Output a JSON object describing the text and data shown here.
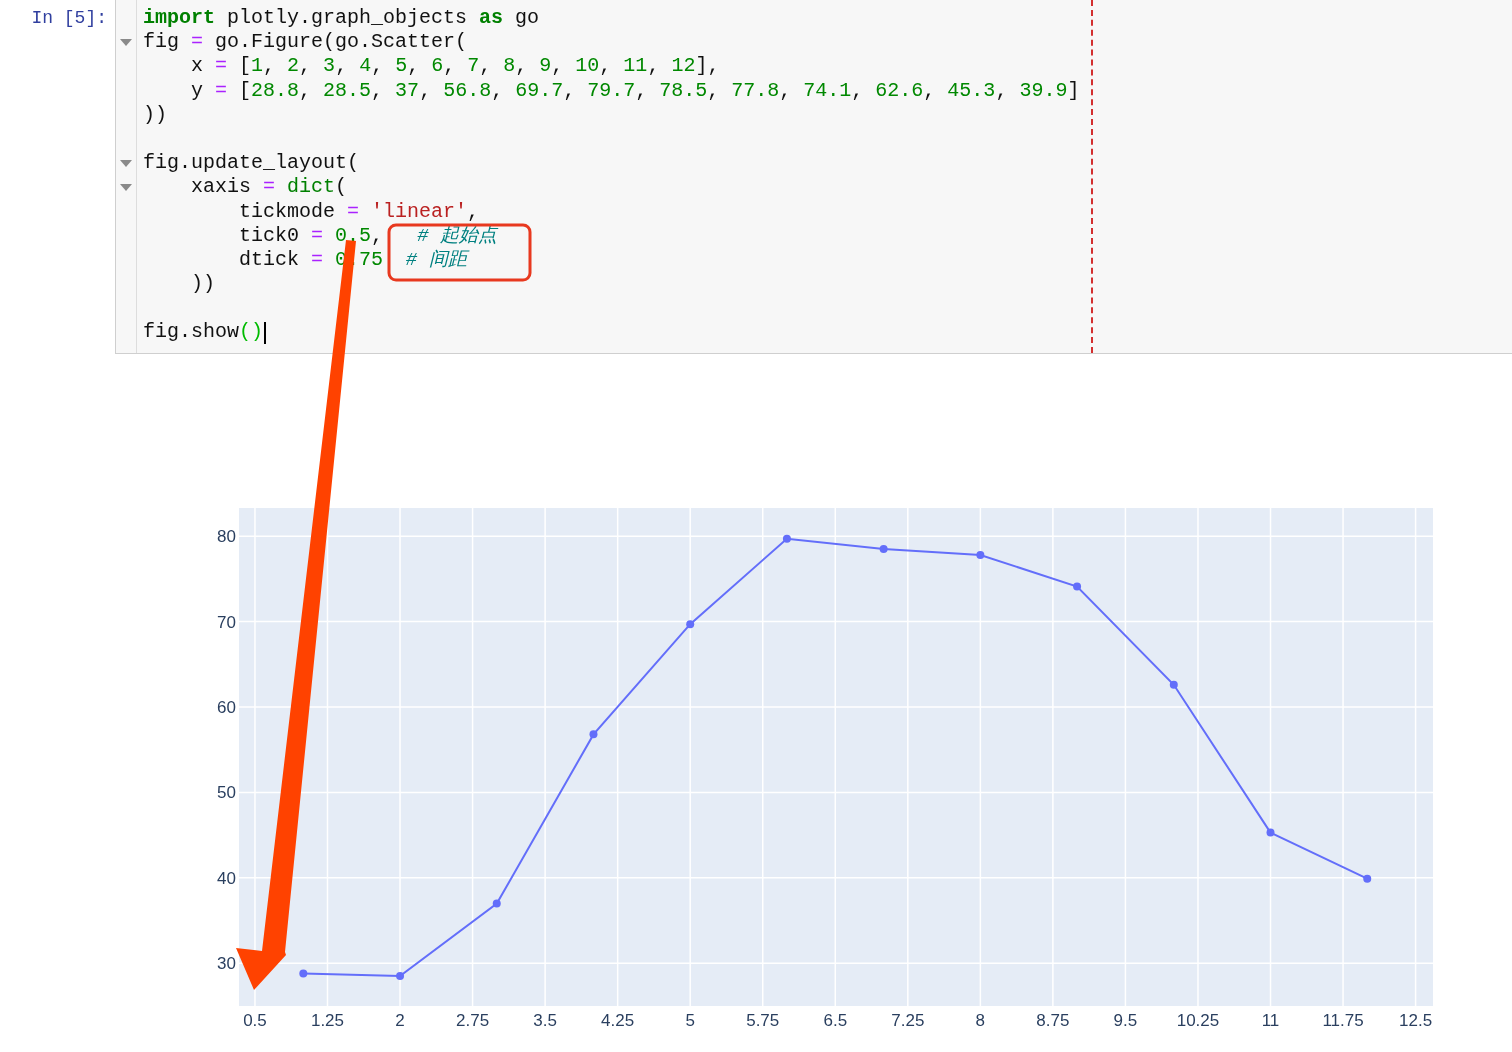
{
  "cell": {
    "prompt": "In [5]:",
    "lines": [
      {
        "fold": false,
        "cursor": false,
        "tokens": [
          {
            "t": "import",
            "kind": "kw"
          },
          {
            "t": " plotly.graph_objects ",
            "kind": "p"
          },
          {
            "t": "as",
            "kind": "kw"
          },
          {
            "t": " go",
            "kind": "p"
          }
        ]
      },
      {
        "fold": true,
        "cursor": false,
        "tokens": [
          {
            "t": "fig ",
            "kind": "p"
          },
          {
            "t": "=",
            "kind": "op"
          },
          {
            "t": " go.Figure(go.Scatter(",
            "kind": "p"
          }
        ]
      },
      {
        "fold": false,
        "cursor": false,
        "tokens": [
          {
            "t": "    x ",
            "kind": "p"
          },
          {
            "t": "=",
            "kind": "op"
          },
          {
            "t": " [",
            "kind": "p"
          },
          {
            "t": "1",
            "kind": "num"
          },
          {
            "t": ", ",
            "kind": "p"
          },
          {
            "t": "2",
            "kind": "num"
          },
          {
            "t": ", ",
            "kind": "p"
          },
          {
            "t": "3",
            "kind": "num"
          },
          {
            "t": ", ",
            "kind": "p"
          },
          {
            "t": "4",
            "kind": "num"
          },
          {
            "t": ", ",
            "kind": "p"
          },
          {
            "t": "5",
            "kind": "num"
          },
          {
            "t": ", ",
            "kind": "p"
          },
          {
            "t": "6",
            "kind": "num"
          },
          {
            "t": ", ",
            "kind": "p"
          },
          {
            "t": "7",
            "kind": "num"
          },
          {
            "t": ", ",
            "kind": "p"
          },
          {
            "t": "8",
            "kind": "num"
          },
          {
            "t": ", ",
            "kind": "p"
          },
          {
            "t": "9",
            "kind": "num"
          },
          {
            "t": ", ",
            "kind": "p"
          },
          {
            "t": "10",
            "kind": "num"
          },
          {
            "t": ", ",
            "kind": "p"
          },
          {
            "t": "11",
            "kind": "num"
          },
          {
            "t": ", ",
            "kind": "p"
          },
          {
            "t": "12",
            "kind": "num"
          },
          {
            "t": "],",
            "kind": "p"
          }
        ]
      },
      {
        "fold": false,
        "cursor": false,
        "tokens": [
          {
            "t": "    y ",
            "kind": "p"
          },
          {
            "t": "=",
            "kind": "op"
          },
          {
            "t": " [",
            "kind": "p"
          },
          {
            "t": "28.8",
            "kind": "num"
          },
          {
            "t": ", ",
            "kind": "p"
          },
          {
            "t": "28.5",
            "kind": "num"
          },
          {
            "t": ", ",
            "kind": "p"
          },
          {
            "t": "37",
            "kind": "num"
          },
          {
            "t": ", ",
            "kind": "p"
          },
          {
            "t": "56.8",
            "kind": "num"
          },
          {
            "t": ", ",
            "kind": "p"
          },
          {
            "t": "69.7",
            "kind": "num"
          },
          {
            "t": ", ",
            "kind": "p"
          },
          {
            "t": "79.7",
            "kind": "num"
          },
          {
            "t": ", ",
            "kind": "p"
          },
          {
            "t": "78.5",
            "kind": "num"
          },
          {
            "t": ", ",
            "kind": "p"
          },
          {
            "t": "77.8",
            "kind": "num"
          },
          {
            "t": ", ",
            "kind": "p"
          },
          {
            "t": "74.1",
            "kind": "num"
          },
          {
            "t": ", ",
            "kind": "p"
          },
          {
            "t": "62.6",
            "kind": "num"
          },
          {
            "t": ", ",
            "kind": "p"
          },
          {
            "t": "45.3",
            "kind": "num"
          },
          {
            "t": ", ",
            "kind": "p"
          },
          {
            "t": "39.9",
            "kind": "num"
          },
          {
            "t": "]",
            "kind": "p"
          }
        ]
      },
      {
        "fold": false,
        "cursor": false,
        "tokens": [
          {
            "t": "))",
            "kind": "p"
          }
        ]
      },
      {
        "fold": false,
        "cursor": false
      },
      {
        "fold": true,
        "cursor": false,
        "tokens": [
          {
            "t": "fig.update_layout(",
            "kind": "p"
          }
        ]
      },
      {
        "fold": true,
        "cursor": false,
        "tokens": [
          {
            "t": "    xaxis ",
            "kind": "p"
          },
          {
            "t": "=",
            "kind": "op"
          },
          {
            "t": " dict",
            "kind": "bi"
          },
          {
            "t": "(",
            "kind": "p"
          }
        ]
      },
      {
        "fold": false,
        "cursor": false,
        "tokens": [
          {
            "t": "        tickmode ",
            "kind": "p"
          },
          {
            "t": "=",
            "kind": "op"
          },
          {
            "t": " 'linear'",
            "kind": "str"
          },
          {
            "t": ",",
            "kind": "p"
          }
        ]
      },
      {
        "fold": false,
        "cursor": false,
        "tokens": [
          {
            "t": "        tick0 ",
            "kind": "p"
          },
          {
            "t": "=",
            "kind": "op"
          },
          {
            "t": " 0.5",
            "kind": "num"
          },
          {
            "t": ",",
            "kind": "p"
          },
          {
            "t": "   # 起始点",
            "kind": "cmt"
          }
        ]
      },
      {
        "fold": false,
        "cursor": false,
        "tokens": [
          {
            "t": "        dtick ",
            "kind": "p"
          },
          {
            "t": "=",
            "kind": "op"
          },
          {
            "t": " 0.75",
            "kind": "num"
          },
          {
            "t": "  # 间距",
            "kind": "cmt"
          }
        ]
      },
      {
        "fold": false,
        "cursor": false,
        "tokens": [
          {
            "t": "    ))",
            "kind": "p"
          }
        ]
      },
      {
        "fold": false,
        "cursor": false
      },
      {
        "fold": false,
        "cursor": true,
        "tokens": [
          {
            "t": "fig.show",
            "kind": "p"
          },
          {
            "t": "()",
            "kind": "match"
          }
        ]
      }
    ]
  },
  "figure": {
    "chart_data": {
      "type": "line",
      "grid": true,
      "x": [
        1,
        2,
        3,
        4,
        5,
        6,
        7,
        8,
        9,
        10,
        11,
        12
      ],
      "series": [
        {
          "color": "#636efa",
          "marker": true,
          "values": [
            28.8,
            28.5,
            37,
            56.8,
            69.7,
            79.7,
            78.5,
            77.8,
            74.1,
            62.6,
            45.3,
            39.9
          ]
        }
      ],
      "xlim": [
        0.335,
        12.68
      ],
      "ylim": [
        25,
        83.3
      ],
      "xticks": [
        0.5,
        1.25,
        2,
        2.75,
        3.5,
        4.25,
        5,
        5.75,
        6.5,
        7.25,
        8,
        8.75,
        9.5,
        10.25,
        11,
        11.75,
        12.5
      ],
      "yticks": [
        30,
        40,
        50,
        60,
        70,
        80
      ]
    }
  }
}
